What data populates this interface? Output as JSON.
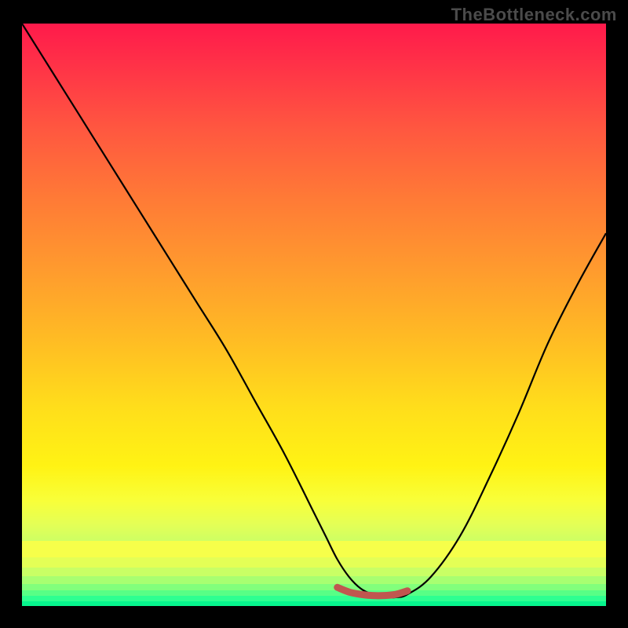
{
  "watermark": "TheBottleneck.com",
  "colors": {
    "frame_bg": "#000000",
    "curve_stroke": "#000000",
    "marker_stroke": "#c0564f",
    "watermark_text": "#4b4b4b"
  },
  "chart_data": {
    "type": "line",
    "title": "",
    "xlabel": "",
    "ylabel": "",
    "xlim": [
      0,
      100
    ],
    "ylim": [
      0,
      100
    ],
    "series": [
      {
        "name": "bottleneck-curve",
        "x": [
          0,
          5,
          10,
          15,
          20,
          25,
          30,
          35,
          40,
          45,
          50,
          52,
          54,
          56,
          58,
          60,
          62,
          64,
          66,
          70,
          75,
          80,
          85,
          90,
          95,
          100
        ],
        "values": [
          100,
          92,
          84,
          76,
          68,
          60,
          52,
          44,
          35,
          26,
          16,
          12,
          8,
          5,
          3,
          2,
          1.5,
          1.5,
          2,
          5,
          12,
          22,
          33,
          45,
          55,
          64
        ]
      },
      {
        "name": "optimal-flat-marker",
        "x": [
          54,
          56,
          58,
          60,
          62,
          64,
          66
        ],
        "values": [
          3.2,
          2.4,
          2,
          1.8,
          1.8,
          2,
          2.6
        ]
      }
    ],
    "gradient_stops": [
      {
        "pct": 0,
        "color": "#ff1a4b"
      },
      {
        "pct": 18,
        "color": "#ff5740"
      },
      {
        "pct": 42,
        "color": "#ff9a2e"
      },
      {
        "pct": 66,
        "color": "#ffde1b"
      },
      {
        "pct": 86,
        "color": "#e4ff56"
      },
      {
        "pct": 100,
        "color": "#07f58e"
      }
    ],
    "bottom_bands": [
      {
        "height_pct": 2.8,
        "color": "#f6ff4a"
      },
      {
        "height_pct": 1.8,
        "color": "#e4ff56"
      },
      {
        "height_pct": 1.5,
        "color": "#c9ff65"
      },
      {
        "height_pct": 1.3,
        "color": "#a8ff71"
      },
      {
        "height_pct": 1.1,
        "color": "#82ff7c"
      },
      {
        "height_pct": 1.0,
        "color": "#58ff86"
      },
      {
        "height_pct": 0.9,
        "color": "#2eff91"
      },
      {
        "height_pct": 0.8,
        "color": "#07f58e"
      }
    ]
  }
}
